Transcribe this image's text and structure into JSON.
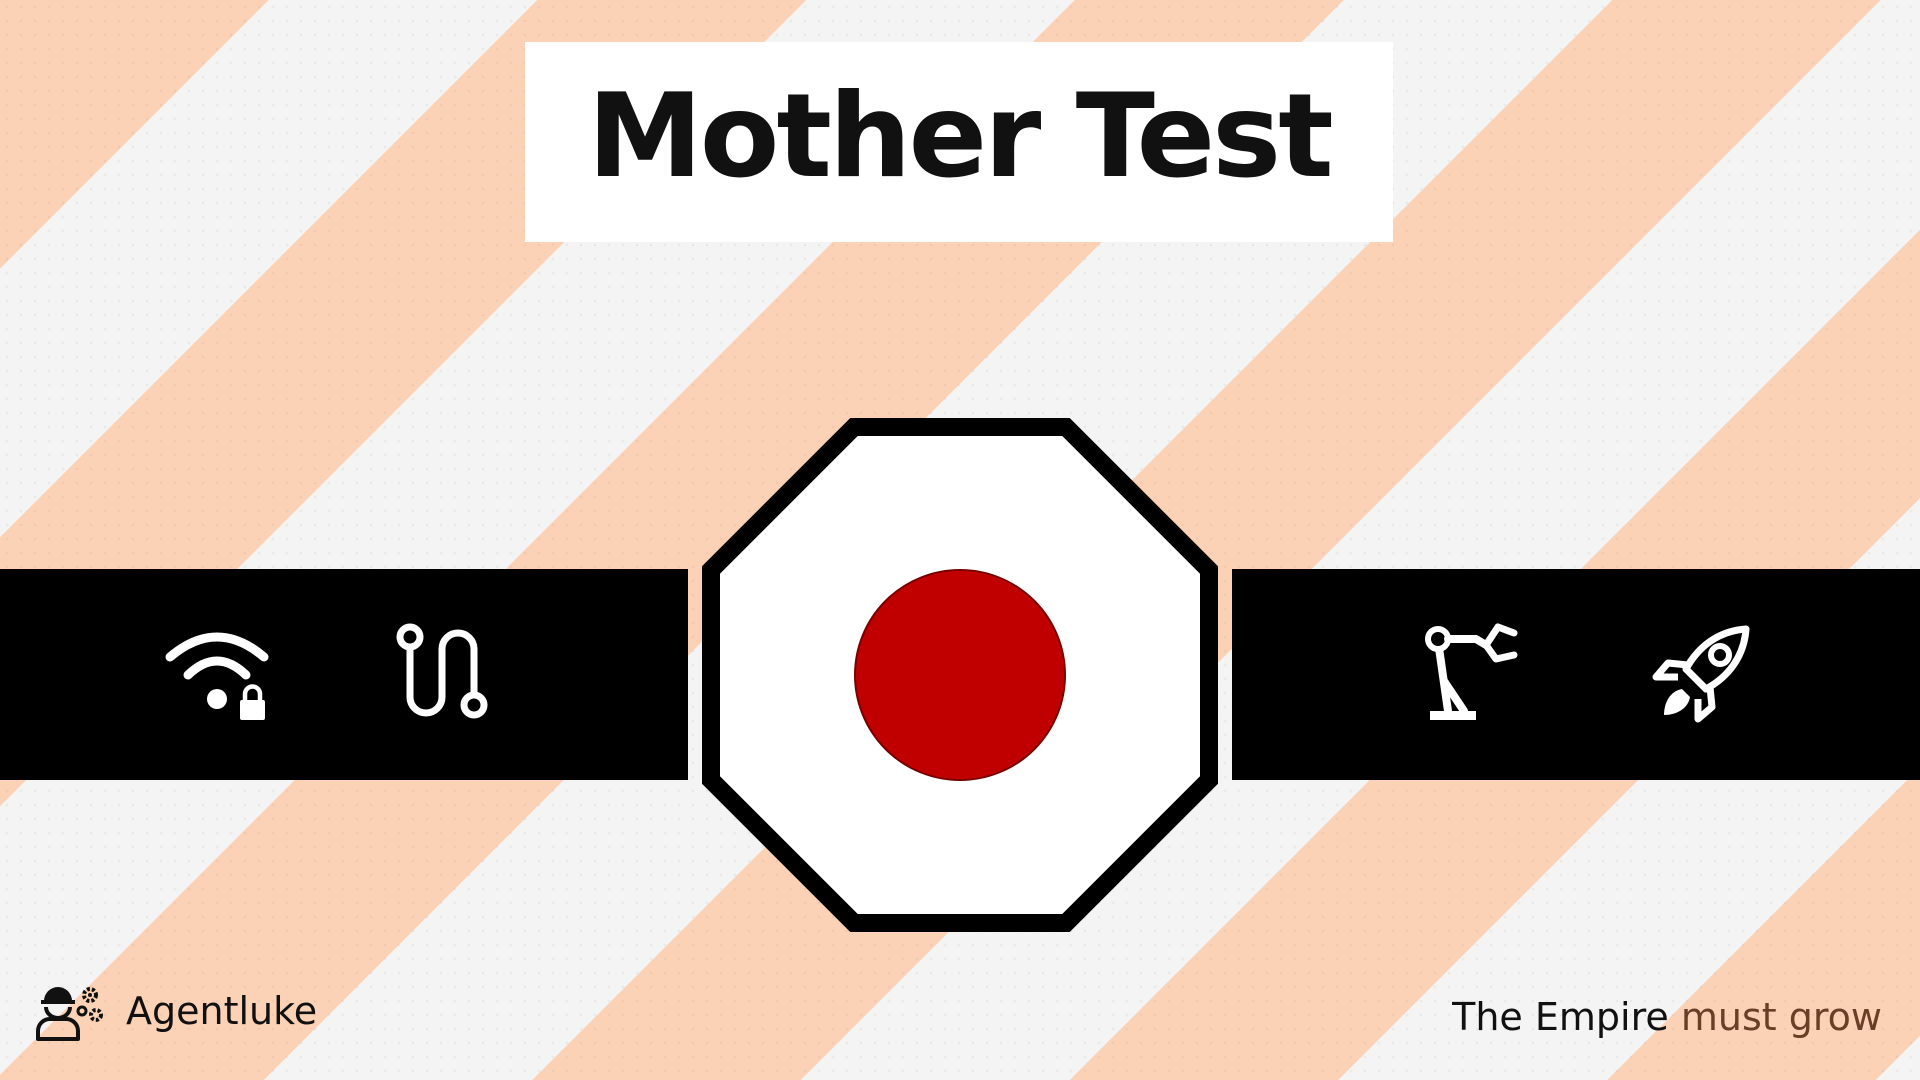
{
  "title": "Mother Test",
  "brand": {
    "name": "Agentluke",
    "icon": "worker-gears-icon"
  },
  "tagline": {
    "part1": "The Empire",
    "part2": "must grow"
  },
  "band_left": {
    "icons": [
      "wifi-lock-icon",
      "route-icon"
    ]
  },
  "band_right": {
    "icons": [
      "robot-arm-icon",
      "rocket-icon"
    ]
  },
  "center_button": {
    "icon": "red-dot-octagon-icon"
  },
  "colors": {
    "stripe": "#fcd2b6",
    "background": "#f4f4f4",
    "band": "#000000",
    "button_red": "#c00000",
    "tagline_accent": "#6b3e26"
  }
}
